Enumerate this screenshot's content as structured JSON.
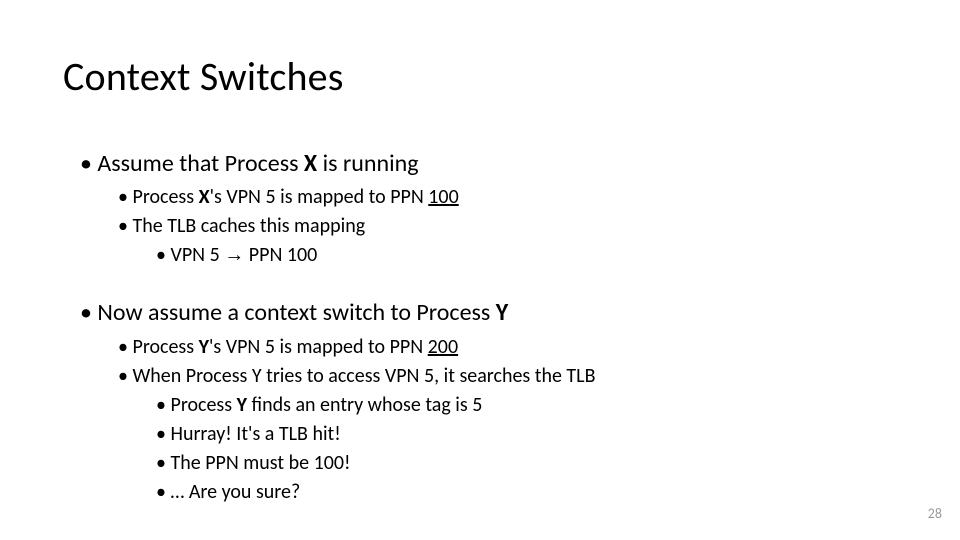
{
  "title": "Context Switches",
  "section1": {
    "heading_pre": "Assume that Process ",
    "heading_bold": "X",
    "heading_post": " is running",
    "sub1_pre": "Process ",
    "sub1_bold": "X",
    "sub1_mid": "'s VPN 5 is mapped to PPN ",
    "sub1_under": "100",
    "sub2": "The TLB caches this mapping",
    "sub3_pre": "VPN 5 ",
    "sub3_arrow": "→",
    "sub3_post": " PPN 100"
  },
  "section2": {
    "heading_pre": "Now assume a context switch to Process ",
    "heading_bold": "Y",
    "sub1_pre": "Process ",
    "sub1_bold": "Y",
    "sub1_mid": "'s VPN 5 is mapped to PPN ",
    "sub1_under": "200",
    "sub2": "When Process Y tries to access VPN 5, it searches the TLB",
    "sub3_pre": "Process ",
    "sub3_bold": "Y",
    "sub3_post": " finds an entry whose tag is 5",
    "sub4": "Hurray! It's a TLB hit!",
    "sub5": "The PPN must be 100!",
    "sub6": "… Are you sure?"
  },
  "page_number": "28"
}
